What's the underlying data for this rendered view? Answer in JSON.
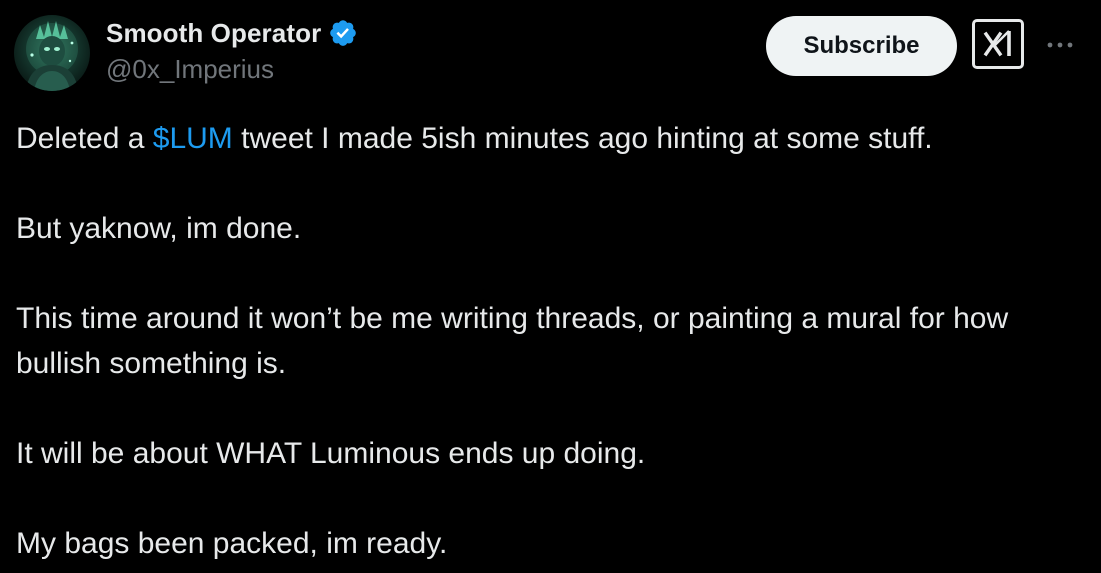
{
  "tweet": {
    "author": {
      "display_name": "Smooth Operator",
      "handle": "@0x_Imperius",
      "verified": true,
      "avatar_icon": "avatar-image"
    },
    "actions": {
      "subscribe_label": "Subscribe",
      "grok_icon": "grok-icon",
      "more_icon": "more-icon"
    },
    "paragraphs": [
      {
        "before": "Deleted a ",
        "cashtag": "$LUM",
        "after": " tweet I made 5ish minutes ago hinting at some stuff."
      },
      {
        "text": "But yaknow, im done."
      },
      {
        "text": "This time around it won’t be me writing threads, or painting a mural for how bullish something is."
      },
      {
        "text": "It will be about WHAT Luminous ends up doing."
      },
      {
        "text": "My bags been packed, im ready."
      }
    ]
  },
  "colors": {
    "background": "#000000",
    "text_primary": "#e7e9ea",
    "text_secondary": "#71767b",
    "link": "#1d9bf0",
    "verified_badge": "#1d9bf0",
    "subscribe_bg": "#eff3f4",
    "subscribe_text": "#0f1419"
  }
}
